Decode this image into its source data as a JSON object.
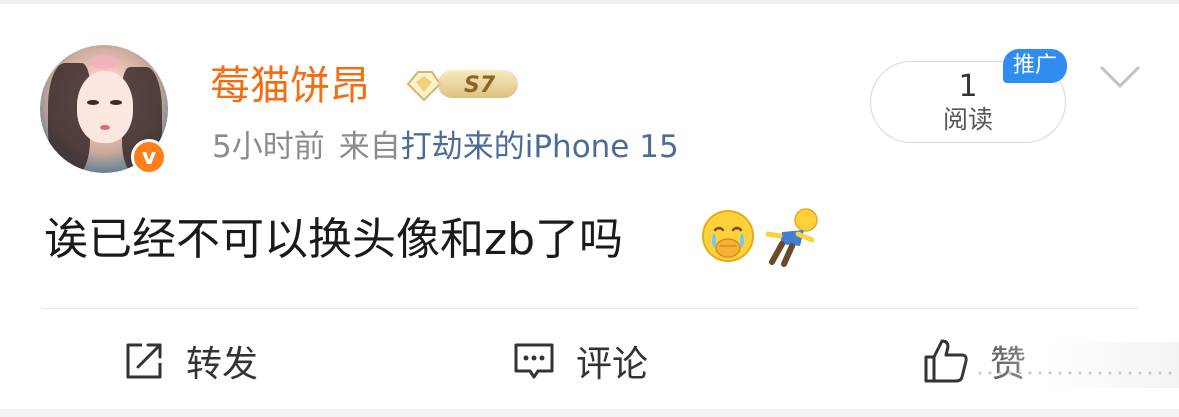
{
  "post": {
    "author": {
      "name": "莓猫饼昂",
      "rank_badge": "S7",
      "verified": true,
      "avatar": "user-avatar"
    },
    "time": "5小时前",
    "source_label": "来自",
    "source_device": "打劫来的iPhone 15",
    "text": "诶已经不可以换头像和zb了吗",
    "emojis": [
      "crying-emoji",
      "falling-figure-emoji"
    ],
    "reads": {
      "count": "1",
      "label": "阅读"
    },
    "promo_tag": "推广"
  },
  "actions": {
    "repost": "转发",
    "comment": "评论",
    "like": "赞"
  },
  "colors": {
    "username": "#f56d13",
    "device_link": "#4d6b99",
    "promo": "#2f8cf1",
    "verified": "#ff7f19"
  }
}
